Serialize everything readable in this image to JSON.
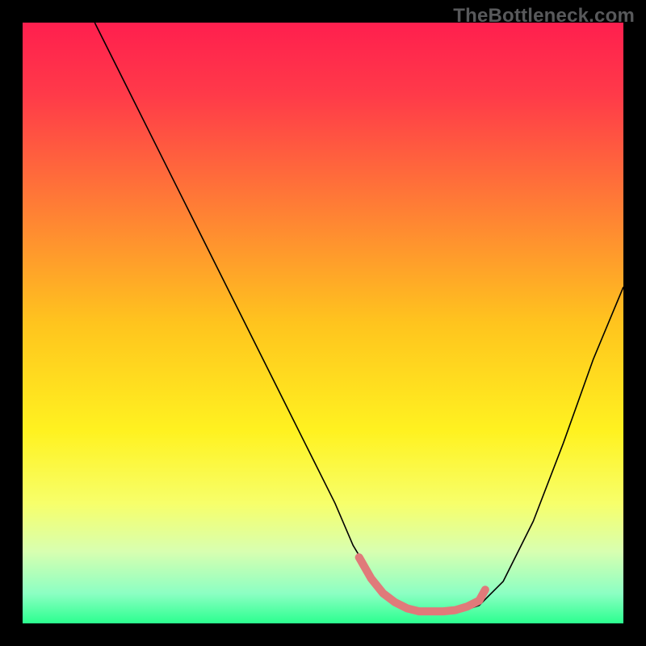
{
  "watermark": "TheBottleneck.com",
  "chart_data": {
    "type": "line",
    "title": "",
    "xlabel": "",
    "ylabel": "",
    "xlim": [
      0,
      100
    ],
    "ylim": [
      0,
      100
    ],
    "grid": false,
    "background_gradient": {
      "stops": [
        {
          "offset": 0.0,
          "color": "#ff1f4e"
        },
        {
          "offset": 0.12,
          "color": "#ff3a49"
        },
        {
          "offset": 0.3,
          "color": "#ff7b36"
        },
        {
          "offset": 0.5,
          "color": "#ffc41e"
        },
        {
          "offset": 0.68,
          "color": "#fff220"
        },
        {
          "offset": 0.8,
          "color": "#f7ff6a"
        },
        {
          "offset": 0.88,
          "color": "#d8ffb0"
        },
        {
          "offset": 0.95,
          "color": "#8cffc3"
        },
        {
          "offset": 1.0,
          "color": "#2bff8f"
        }
      ]
    },
    "series": [
      {
        "name": "bottleneck-curve",
        "stroke": "#000000",
        "stroke_width": 1.6,
        "x": [
          12,
          17,
          22,
          27,
          32,
          37,
          42,
          47,
          52,
          55,
          58,
          60,
          63,
          66,
          70,
          73,
          76,
          80,
          85,
          90,
          95,
          100
        ],
        "y": [
          100,
          90,
          80,
          70,
          60,
          50,
          40,
          30,
          20,
          13,
          8,
          5,
          3,
          2,
          2,
          2,
          3,
          7,
          17,
          30,
          44,
          56
        ]
      }
    ],
    "highlight": {
      "name": "bottleneck-sweet-spot",
      "stroke": "#e07a7a",
      "stroke_width": 10,
      "linecap": "round",
      "x": [
        56,
        58,
        60,
        62,
        64,
        66,
        68,
        70,
        72,
        74,
        76,
        77
      ],
      "y": [
        11.0,
        7.5,
        5.0,
        3.5,
        2.5,
        2.0,
        2.0,
        2.0,
        2.2,
        2.8,
        3.8,
        5.6
      ]
    }
  }
}
